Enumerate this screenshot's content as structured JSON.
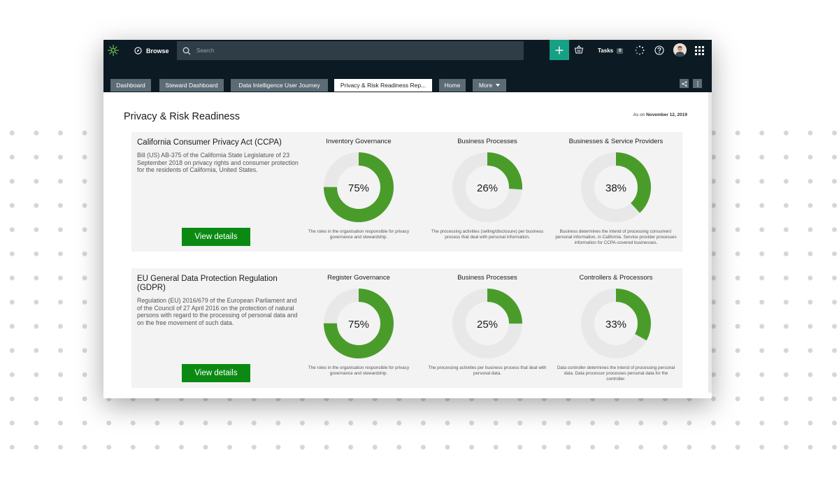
{
  "topbar": {
    "browse_label": "Browse",
    "search_placeholder": "Search",
    "tasks_label": "Tasks",
    "tasks_count": "0",
    "accent_color": "#16a085"
  },
  "tabs": [
    {
      "label": "Dashboard"
    },
    {
      "label": "Steward Dashboard"
    },
    {
      "label": "Data Intelligence User Journey"
    },
    {
      "label": "Privacy & Risk Readiness Rep..."
    },
    {
      "label": "Home"
    },
    {
      "label": "More"
    }
  ],
  "page": {
    "title": "Privacy & Risk Readiness",
    "as_on_label": "As on",
    "as_on_date": "November 12, 2019"
  },
  "colors": {
    "donut_fill": "#4a9c2a",
    "donut_track": "#e8e8e8",
    "button": "#0a8a12"
  },
  "cards": [
    {
      "title": "California Consumer Privacy Act (CCPA)",
      "description": "Bill (US) AB-375 of the California State Legislature of 23 September 2018 on privacy rights and consumer protection for the residents of California, United States.",
      "button_label": "View details",
      "metrics": [
        {
          "title": "Inventory Governance",
          "value": 75,
          "label": "75%",
          "description": "The roles in the organisation responsible for privacy governance and stewardship."
        },
        {
          "title": "Business Processes",
          "value": 26,
          "label": "26%",
          "description": "The processing activities (selling/disclosure) per business process that deal with personal information."
        },
        {
          "title": "Businesses & Service Providers",
          "value": 38,
          "label": "38%",
          "description": "Business determines the intend of processing consumers' personal information, in California. Service provider processes information for CCPA-covered businesses."
        }
      ]
    },
    {
      "title": "EU General Data Protection Regulation (GDPR)",
      "description": "Regulation (EU) 2016/679 of the European Parliament and of the Council of 27 April 2016 on the protection of natural persons with regard to the processing of personal data and on the free movement of such data.",
      "button_label": "View details",
      "metrics": [
        {
          "title": "Register Governance",
          "value": 75,
          "label": "75%",
          "description": "The roles in the organisation responsible for privacy governance and stewardship."
        },
        {
          "title": "Business Processes",
          "value": 25,
          "label": "25%",
          "description": "The processing activities per business process that deal with personal data."
        },
        {
          "title": "Controllers & Processors",
          "value": 33,
          "label": "33%",
          "description": "Data controller determines the intend of processing personal data. Data processor processes personal data for the controller."
        }
      ]
    }
  ]
}
